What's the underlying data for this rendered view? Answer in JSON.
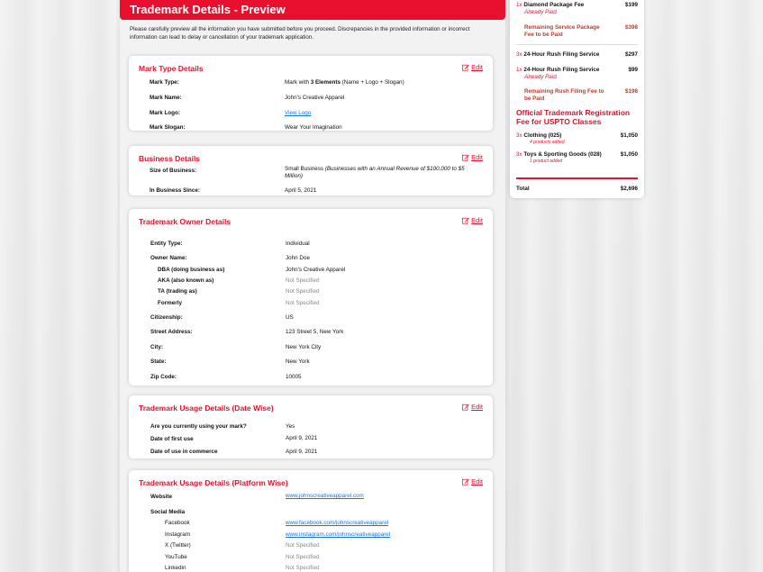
{
  "header": {
    "title": "Trademark Details - Preview"
  },
  "intro": "Please carefully preview all the information you have submitted before you proceed. Discrepancies in the provided information or incorrect information can lead to delay or cancellation of your trademark application.",
  "edit_label": "Edit",
  "mark_type": {
    "title": "Mark Type Details",
    "rows": [
      {
        "label": "Mark Type:",
        "value_pre": "Mark with ",
        "value_bold": "3 Elements",
        "value_post": " (Name + Logo + Slogan)"
      },
      {
        "label": "Mark Name:",
        "value": "John's Creative Apparel"
      },
      {
        "label": "Mark Logo:",
        "value": "View Logo"
      },
      {
        "label": "Mark Slogan:",
        "value": "Wear Your Imagination"
      }
    ]
  },
  "business": {
    "title": "Business Details",
    "size_label": "Size of Business:",
    "size_value": "Small Business",
    "size_note": "(Businesses with an Annual Revenue of $100,000 to $5 Million)",
    "since_label": "In Business Since:",
    "since_value": "April 5, 2021"
  },
  "owner": {
    "title": "Trademark Owner Details",
    "rows": [
      {
        "label": "Entity Type:",
        "value": "Individual"
      },
      {
        "label": "Owner Name:",
        "value": "John Doe"
      },
      {
        "label": "DBA (doing business as)",
        "value": "John's Creative Apparel"
      },
      {
        "label": "AKA (also known as)",
        "value": "Not Specified"
      },
      {
        "label": "TA (trading as)",
        "value": "Not Specified"
      },
      {
        "label": "Formerly",
        "value": "Not Specified"
      },
      {
        "label": "Citizenship:",
        "value": "US"
      },
      {
        "label": "Street Address:",
        "value": "123 Street 5, New York"
      },
      {
        "label": "City:",
        "value": "New York City"
      },
      {
        "label": "State:",
        "value": "New York"
      },
      {
        "label": "Zip Code:",
        "value": "10005"
      }
    ]
  },
  "usage_date": {
    "title": "Trademark Usage Details (Date Wise)",
    "rows": [
      {
        "label": "Are you currently using your mark?",
        "value": "Yes"
      },
      {
        "label": "Date of first use",
        "value": "April 9, 2021"
      },
      {
        "label": "Date of use in commerce",
        "value": "April 9, 2021"
      }
    ]
  },
  "usage_platform": {
    "title": "Trademark Usage Details (Platform Wise)",
    "website_label": "Website",
    "website_value": "www.johnscreativeapparel.com",
    "social_label": "Social Media",
    "social": [
      {
        "label": "Facebook",
        "value": "www.facebook.com/johnscreativeapparel"
      },
      {
        "label": "Instagram",
        "value": "www.instagram.com/johnscreativeapparel"
      },
      {
        "label": "X (Twitter)",
        "value": "Not Specified"
      },
      {
        "label": "YouTube",
        "value": "Not Specified"
      },
      {
        "label": "Linkedin",
        "value": "Not Specified"
      }
    ]
  },
  "summary": {
    "items": [
      {
        "qty": "1x",
        "name": "Diamond Package Fee",
        "price": "$199",
        "sub": "Already Paid"
      },
      {
        "name": "Remaining Service Package Fee to be Paid",
        "price": "$398"
      },
      {
        "qty": "3x",
        "name": "24-Hour Rush Filing Service",
        "price": "$297"
      },
      {
        "qty": "1x",
        "name": "24-Hour Rush Filing Service",
        "price": "$99",
        "sub": "Already Paid"
      },
      {
        "name": "Remaining Rush Filing Fee to be Paid",
        "price": "$198"
      }
    ],
    "uspto_heading": "Official Trademark Registration Fee for USPTO Classes",
    "classes": [
      {
        "qty": "3x",
        "name": "Clothing (025)",
        "price": "$1,050",
        "sub": "4 products added"
      },
      {
        "qty": "3x",
        "name": "Toys & Sporting Goods (028)",
        "price": "$1,050",
        "sub": "1 product added"
      }
    ],
    "total_label": "Total",
    "total_value": "$2,696"
  },
  "colors": {
    "accent": "#e8102e",
    "link": "#1a73e8"
  }
}
